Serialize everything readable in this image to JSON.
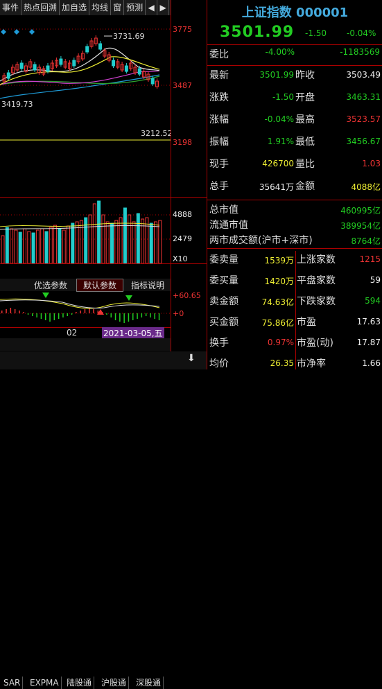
{
  "top_tabs": [
    "事件",
    "热点回溯",
    "加自选",
    "均线",
    "窗",
    "预测",
    "◀",
    "▶"
  ],
  "price_axis": [
    "3775",
    "3487",
    "3198"
  ],
  "price_annot": {
    "high": "3731.69",
    "left": "3419.73",
    "low": "3212.52"
  },
  "volume_axis": [
    "4888",
    "2479",
    "X10"
  ],
  "macd_tabs": [
    "优选参数",
    "默认参数",
    "指标说明"
  ],
  "macd_axis": [
    "+60.65",
    "+0"
  ],
  "date_axis": {
    "month": "02",
    "cursor": "2021-03-05,五"
  },
  "bottom_tabs": [
    "SAR",
    "EXPMA",
    "陆股通",
    "沪股通",
    "深股通"
  ],
  "header": {
    "title": "上证指数 000001",
    "price": "3501.99",
    "change": "-1.50",
    "pct": "-0.04%"
  },
  "weibi": {
    "label": "委比",
    "pct": "-4.00%",
    "diff": "-1183569"
  },
  "quote": [
    {
      "l1": "最新",
      "v1": "3501.99",
      "c1": "g",
      "l2": "昨收",
      "v2": "3503.49",
      "c2": "w"
    },
    {
      "l1": "涨跌",
      "v1": "-1.50",
      "c1": "g",
      "l2": "开盘",
      "v2": "3463.31",
      "c2": "g"
    },
    {
      "l1": "涨幅",
      "v1": "-0.04%",
      "c1": "g",
      "l2": "最高",
      "v2": "3523.57",
      "c2": "r"
    },
    {
      "l1": "振幅",
      "v1": "1.91%",
      "c1": "g",
      "l2": "最低",
      "v2": "3456.67",
      "c2": "g"
    },
    {
      "l1": "现手",
      "v1": "426700",
      "c1": "y",
      "l2": "量比",
      "v2": "1.03",
      "c2": "r"
    },
    {
      "l1": "总手",
      "v1": "35641万",
      "c1": "w",
      "l2": "金额",
      "v2": "4088亿",
      "c2": "y"
    }
  ],
  "market": [
    {
      "label": "总市值",
      "value": "460995亿"
    },
    {
      "label": "流通市值",
      "value": "389954亿"
    },
    {
      "label": "两市成交额(沪市+深市)",
      "value": "8764亿"
    }
  ],
  "breadth": [
    {
      "l1": "委卖量",
      "v1": "1539万",
      "c1": "y",
      "l2": "上涨家数",
      "v2": "1215",
      "c2": "r"
    },
    {
      "l1": "委买量",
      "v1": "1420万",
      "c1": "y",
      "l2": "平盘家数",
      "v2": "59",
      "c2": "w"
    },
    {
      "l1": "卖金额",
      "v1": "74.63亿",
      "c1": "y",
      "l2": "下跌家数",
      "v2": "594",
      "c2": "g"
    },
    {
      "l1": "买金额",
      "v1": "75.86亿",
      "c1": "y",
      "l2": "市盈",
      "v2": "17.63",
      "c2": "w"
    },
    {
      "l1": "换手",
      "v1": "0.97%",
      "c1": "r",
      "l2": "市盈(动)",
      "v2": "17.87",
      "c2": "w"
    },
    {
      "l1": "均价",
      "v1": "26.35",
      "c1": "y",
      "l2": "市净率",
      "v2": "1.66",
      "c2": "w"
    }
  ],
  "colors": {
    "up": "#ee3333",
    "down": "#22cc22",
    "accent": "#44aadd",
    "yellow": "#eeee33"
  }
}
